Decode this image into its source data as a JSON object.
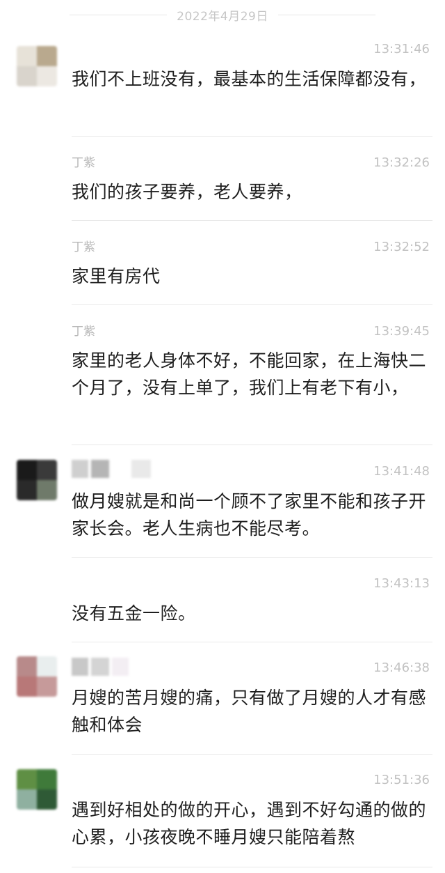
{
  "date_separator": "2022年4月29日",
  "messages": [
    {
      "sender": "",
      "time": "13:31:46",
      "text": "我们不上班没有，最基本的生活保障都没有，"
    },
    {
      "sender": "丁紫",
      "time": "13:32:26",
      "text": "我们的孩子要养，老人要养，"
    },
    {
      "sender": "丁紫",
      "time": "13:32:52",
      "text": "家里有房代"
    },
    {
      "sender": "丁紫",
      "time": "13:39:45",
      "text": "家里的老人身体不好，不能回家，在上海快二个月了，没有上单了，我们上有老下有小，"
    },
    {
      "sender": "",
      "time": "13:41:48",
      "text": "做月嫂就是和尚一个顾不了家里不能和孩子开家长会。老人生病也不能尽考。"
    },
    {
      "sender": "",
      "time": "13:43:13",
      "text": "没有五金一险。"
    },
    {
      "sender": "",
      "time": "13:46:38",
      "text": "月嫂的苦月嫂的痛，只有做了月嫂的人才有感触和体会"
    },
    {
      "sender": "",
      "time": "13:51:36",
      "text": "遇到好相处的做的开心，遇到不好勾通的做的心累，小孩夜晚不睡月嫂只能陪着熬"
    }
  ],
  "colors": {
    "background": "#ffffff",
    "text": "#1e1e1e",
    "meta": "#c2c2c2",
    "divider": "#e9e9e9"
  }
}
